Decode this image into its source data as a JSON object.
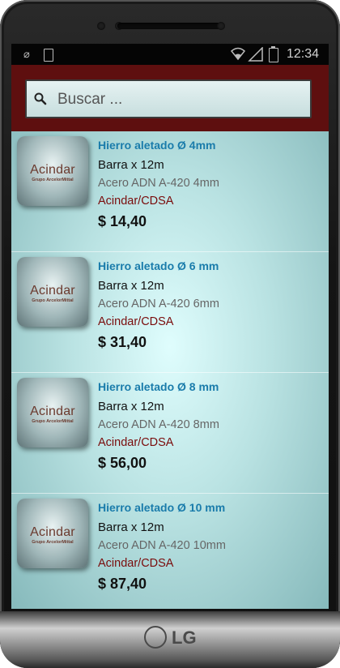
{
  "status_bar": {
    "time": "12:34",
    "icons": [
      "usb-icon",
      "battery-small-icon",
      "wifi-icon",
      "signal-icon",
      "battery-icon"
    ]
  },
  "search": {
    "placeholder": "Buscar ...",
    "value": ""
  },
  "products": [
    {
      "title": "Hierro aletado Ø 4mm",
      "line1": "Barra x 12m",
      "line2": "Acero ADN A-420 4mm",
      "supplier": "Acindar/CDSA",
      "price": "$ 14,40",
      "brand": "Acindar",
      "brand_sub": "Grupo ArcelorMittal"
    },
    {
      "title": "Hierro aletado Ø 6 mm",
      "line1": "Barra x 12m",
      "line2": "Acero ADN A-420 6mm",
      "supplier": "Acindar/CDSA",
      "price": "$ 31,40",
      "brand": "Acindar",
      "brand_sub": "Grupo ArcelorMittal"
    },
    {
      "title": "Hierro aletado Ø 8 mm",
      "line1": "Barra x 12m",
      "line2": "Acero ADN A-420 8mm",
      "supplier": "Acindar/CDSA",
      "price": "$ 56,00",
      "brand": "Acindar",
      "brand_sub": "Grupo ArcelorMittal"
    },
    {
      "title": "Hierro aletado Ø 10 mm",
      "line1": "Barra x 12m",
      "line2": "Acero ADN A-420 10mm",
      "supplier": "Acindar/CDSA",
      "price": "$ 87,40",
      "brand": "Acindar",
      "brand_sub": "Grupo ArcelorMittal"
    }
  ],
  "device": {
    "brand": "LG"
  },
  "colors": {
    "search_bar_bg": "#5e0f0f",
    "title_blue": "#1a7cab",
    "supplier_red": "#7a0c0c"
  }
}
